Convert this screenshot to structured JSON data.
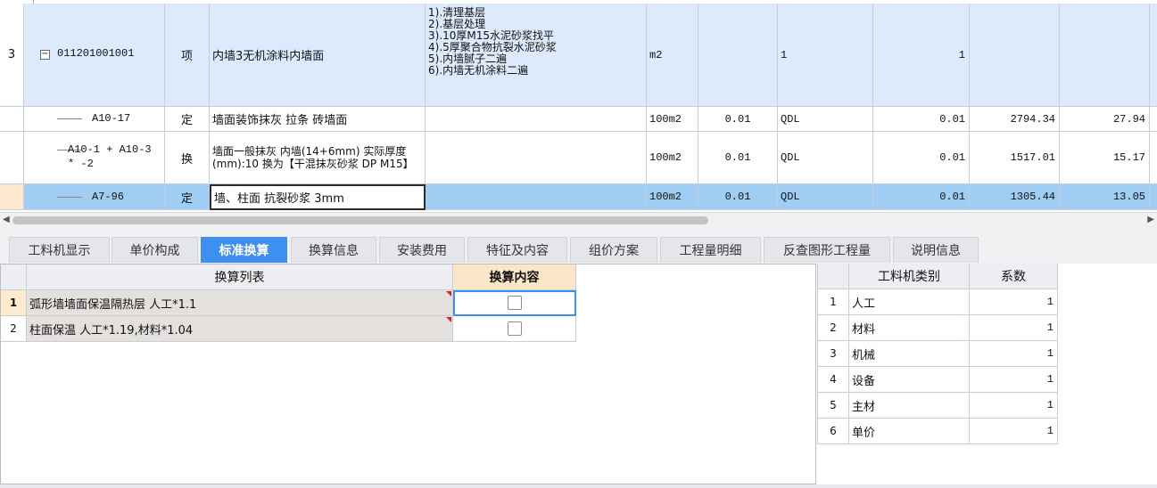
{
  "rows": [
    {
      "num": "3",
      "code": "011201001001",
      "type": "项",
      "name": "内墙3无机涂料内墙面",
      "features": [
        "1).清理基层",
        "2).基层处理",
        "3).10厚M15水泥砂浆找平",
        "4).5厚聚合物抗裂水泥砂浆",
        "5).内墙腻子二遍",
        "6).内墙无机涂料二遍"
      ],
      "unit": "m2",
      "qty_expr": "",
      "formula": "1",
      "quantity": "1",
      "unit_price": "",
      "total": ""
    },
    {
      "num": "",
      "code": "A10-17",
      "type": "定",
      "name": "墙面装饰抹灰 拉条 砖墙面",
      "unit": "100m2",
      "qty_expr": "0.01",
      "formula": "QDL",
      "quantity": "0.01",
      "unit_price": "2794.34",
      "total": "27.94"
    },
    {
      "num": "",
      "code_line1": "A10-1 + A10-3",
      "code_line2": "* -2",
      "type": "换",
      "name": "墙面一般抹灰 内墙(14+6mm) 实际厚度(mm):10 换为【干混抹灰砂浆 DP M15】",
      "unit": "100m2",
      "qty_expr": "0.01",
      "formula": "QDL",
      "quantity": "0.01",
      "unit_price": "1517.01",
      "total": "15.17"
    },
    {
      "num": "",
      "code": "A7-96",
      "type": "定",
      "name": "墙、柱面 抗裂砂浆 3mm",
      "unit": "100m2",
      "qty_expr": "0.01",
      "formula": "QDL",
      "quantity": "0.01",
      "unit_price": "1305.44",
      "total": "13.05"
    }
  ],
  "tabs": [
    "工料机显示",
    "单价构成",
    "标准换算",
    "换算信息",
    "安装费用",
    "特征及内容",
    "组价方案",
    "工程量明细",
    "反查图形工程量",
    "说明信息"
  ],
  "active_tab": "标准换算",
  "conversion": {
    "col_list": "换算列表",
    "col_content": "换算内容",
    "items": [
      {
        "num": "1",
        "text": "弧形墙墙面保温隔热层 人工*1.1",
        "checked": false
      },
      {
        "num": "2",
        "text": "柱面保温 人工*1.19,材料*1.04",
        "checked": false
      }
    ]
  },
  "coefficients": {
    "col_category": "工料机类别",
    "col_factor": "系数",
    "items": [
      {
        "num": "1",
        "category": "人工",
        "factor": "1"
      },
      {
        "num": "2",
        "category": "材料",
        "factor": "1"
      },
      {
        "num": "3",
        "category": "机械",
        "factor": "1"
      },
      {
        "num": "4",
        "category": "设备",
        "factor": "1"
      },
      {
        "num": "5",
        "category": "主材",
        "factor": "1"
      },
      {
        "num": "6",
        "category": "单价",
        "factor": "1"
      }
    ]
  },
  "colors": {
    "accent": "#3d8ff0",
    "row_blue": "#ddeafb",
    "row_selected": "#9fcdf4"
  }
}
